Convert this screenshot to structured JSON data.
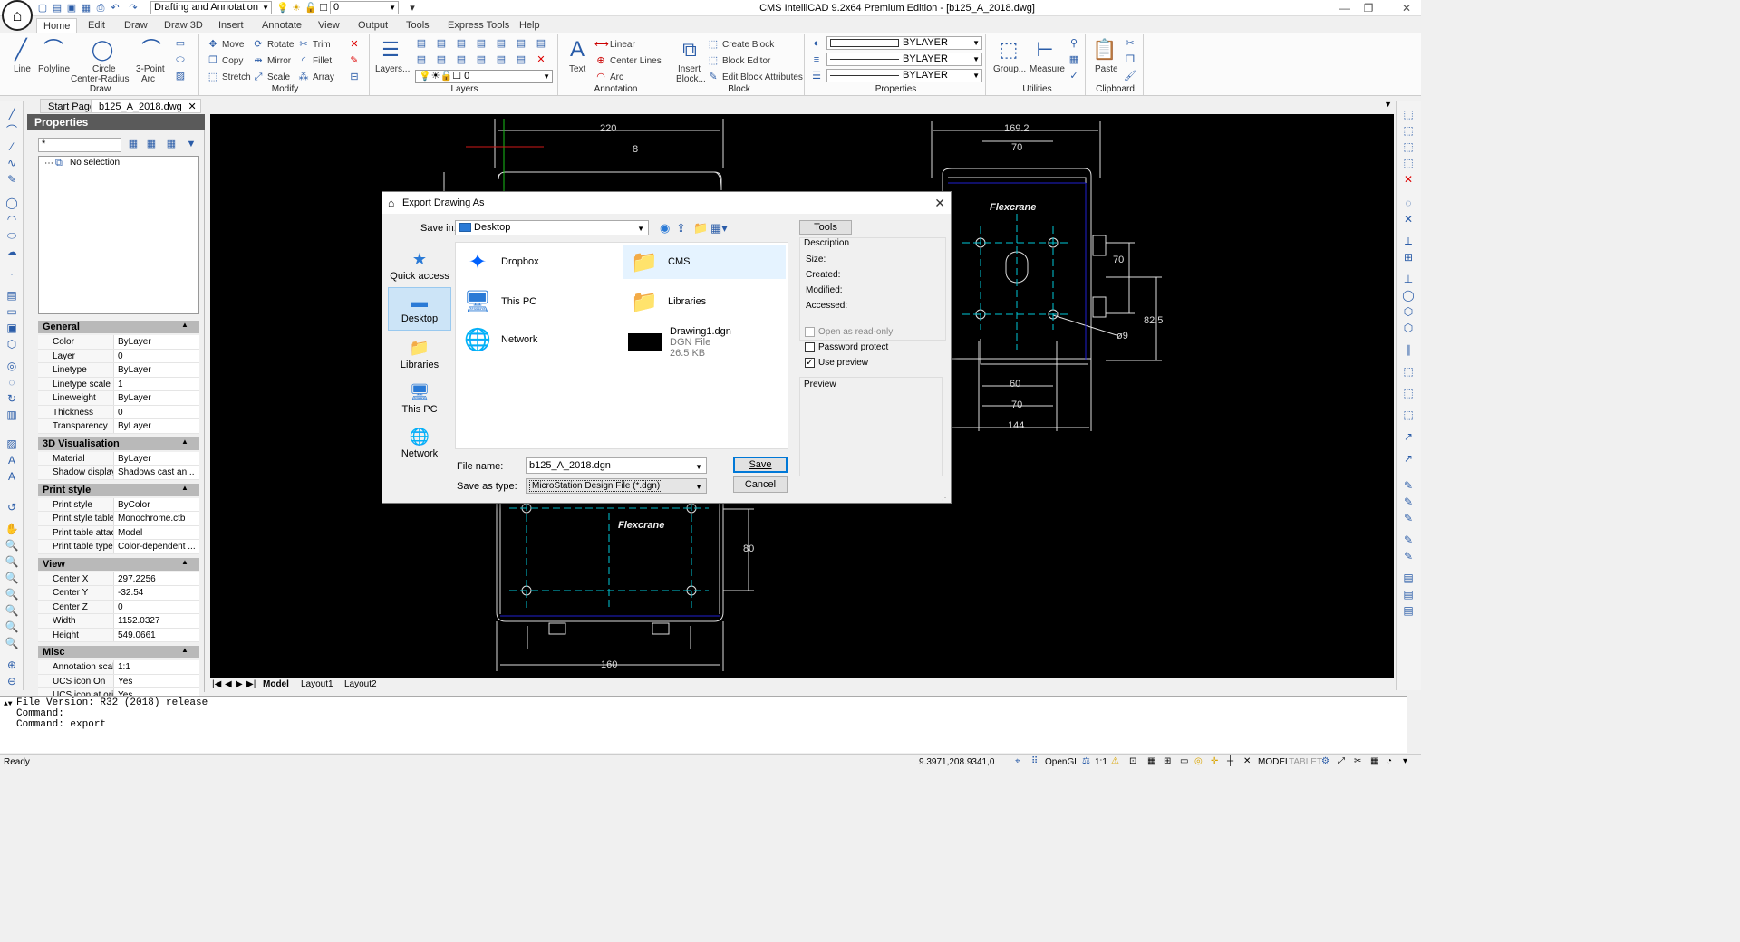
{
  "window": {
    "title": "CMS IntelliCAD 9.2x64 Premium Edition  - [b125_A_2018.dwg]"
  },
  "quickaccess": {
    "workspace": "Drafting and Annotation",
    "layer_value": "0"
  },
  "menutabs": [
    "Home",
    "Edit",
    "Draw",
    "Draw 3D",
    "Insert",
    "Annotate",
    "View",
    "Output",
    "Tools",
    "Express Tools",
    "Help"
  ],
  "ribbon": {
    "draw": {
      "label": "Draw",
      "line": "Line",
      "polyline": "Polyline",
      "circle": "Circle",
      "circle2": "Center-Radius",
      "arc": "3-Point",
      "arc2": "Arc"
    },
    "modify": {
      "label": "Modify",
      "move": "Move",
      "rotate": "Rotate",
      "trim": "Trim",
      "copy": "Copy",
      "mirror": "Mirror",
      "fillet": "Fillet",
      "stretch": "Stretch",
      "scale": "Scale",
      "array": "Array"
    },
    "layers": {
      "label": "Layers",
      "layers_btn": "Layers...",
      "layer_value": "0"
    },
    "annotation": {
      "label": "Annotation",
      "text": "Text",
      "linear": "Linear",
      "center_lines": "Center Lines",
      "arc": "Arc"
    },
    "block": {
      "label": "Block",
      "insert": "Insert",
      "insert2": "Block...",
      "create": "Create Block",
      "editor": "Block Editor",
      "attrs": "Edit Block Attributes"
    },
    "properties": {
      "label": "Properties",
      "color": "BYLAYER",
      "linetype": "BYLAYER",
      "lineweight": "BYLAYER"
    },
    "utilities": {
      "label": "Utilities",
      "group": "Group...",
      "measure": "Measure"
    },
    "clipboard": {
      "label": "Clipboard",
      "paste": "Paste"
    }
  },
  "doctabs": {
    "start": "Start Page",
    "current": "b125_A_2018.dwg"
  },
  "properties_panel": {
    "title": "Properties",
    "filter": "*",
    "selection": "No selection",
    "sections": {
      "general": "General",
      "vis3d": "3D Visualisation",
      "print": "Print style",
      "view": "View",
      "misc": "Misc"
    },
    "general": [
      [
        "Color",
        "ByLayer"
      ],
      [
        "Layer",
        "0"
      ],
      [
        "Linetype",
        "ByLayer"
      ],
      [
        "Linetype scale",
        "1"
      ],
      [
        "Lineweight",
        "ByLayer"
      ],
      [
        "Thickness",
        "0"
      ],
      [
        "Transparency",
        "ByLayer"
      ]
    ],
    "vis3d": [
      [
        "Material",
        "ByLayer"
      ],
      [
        "Shadow display",
        "Shadows cast an..."
      ]
    ],
    "print": [
      [
        "Print style",
        "ByColor"
      ],
      [
        "Print style table",
        "Monochrome.ctb"
      ],
      [
        "Print table attache...",
        "Model"
      ],
      [
        "Print table type",
        "Color-dependent ..."
      ]
    ],
    "view": [
      [
        "Center X",
        "297.2256"
      ],
      [
        "Center Y",
        "-32.54"
      ],
      [
        "Center Z",
        "0"
      ],
      [
        "Width",
        "1152.0327"
      ],
      [
        "Height",
        "549.0661"
      ]
    ],
    "misc": [
      [
        "Annotation scale",
        "1:1"
      ],
      [
        "UCS icon On",
        "Yes"
      ],
      [
        "UCS icon at origin",
        "Yes"
      ]
    ]
  },
  "drawing": {
    "dims": [
      "220",
      "8",
      "169.2",
      "70",
      "70",
      "82.5",
      "ø9",
      "60",
      "70",
      "144",
      "80",
      "160"
    ],
    "brand": "Flexcrane"
  },
  "layout_tabs": [
    "Model",
    "Layout1",
    "Layout2"
  ],
  "command": {
    "lines": [
      "File Version: R32 (2018) release",
      "Command:",
      "Command: export"
    ]
  },
  "status": {
    "ready": "Ready",
    "coords": "9.3971,208.9341,0",
    "opengl": "OpenGL",
    "scale": "1:1",
    "model": "MODEL",
    "tablet": "TABLET"
  },
  "dialog": {
    "title": "Export Drawing As",
    "save_in_label": "Save in:",
    "save_in": "Desktop",
    "tools": "Tools",
    "places": [
      "Quick access",
      "Desktop",
      "Libraries",
      "This PC",
      "Network"
    ],
    "files": [
      {
        "name": "Dropbox"
      },
      {
        "name": "CMS"
      },
      {
        "name": "This PC"
      },
      {
        "name": "Libraries"
      },
      {
        "name": "Network"
      },
      {
        "name": "Drawing1.dgn",
        "type": "DGN File",
        "size": "26.5 KB"
      }
    ],
    "info": {
      "description": "Description",
      "size": "Size:",
      "created": "Created:",
      "modified": "Modified:",
      "accessed": "Accessed:"
    },
    "options": {
      "readonly": "Open as read-only",
      "password": "Password protect",
      "preview": "Use preview"
    },
    "preview_label": "Preview",
    "filename_label": "File name:",
    "filename": "b125_A_2018.dgn",
    "type_label": "Save as type:",
    "type": "MicroStation Design File (*.dgn)",
    "save": "Save",
    "cancel": "Cancel"
  }
}
